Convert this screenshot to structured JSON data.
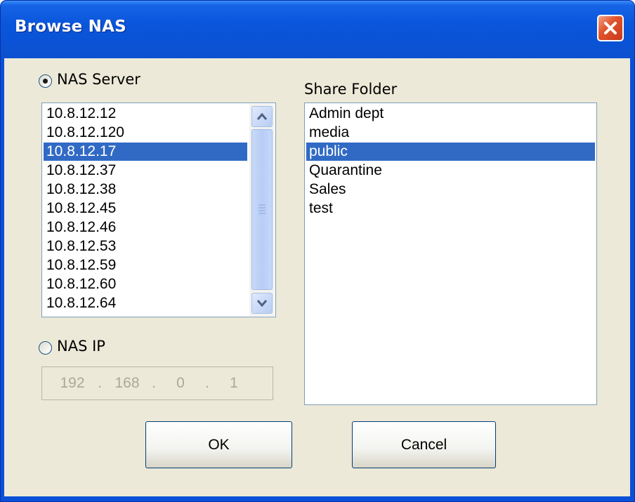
{
  "window": {
    "title": "Browse NAS"
  },
  "nas_server": {
    "label": "NAS Server",
    "selected": true,
    "items": [
      "10.8.12.12",
      "10.8.12.120",
      "10.8.12.17",
      "10.8.12.37",
      "10.8.12.38",
      "10.8.12.45",
      "10.8.12.46",
      "10.8.12.53",
      "10.8.12.59",
      "10.8.12.60",
      "10.8.12.64"
    ],
    "selected_item": "10.8.12.17"
  },
  "nas_ip": {
    "label": "NAS IP",
    "selected": false,
    "octets": [
      "192",
      "168",
      "0",
      "1"
    ],
    "separator": "."
  },
  "share_folder": {
    "label": "Share Folder",
    "items": [
      "Admin dept",
      "media",
      "public",
      "Quarantine",
      "Sales",
      "test"
    ],
    "selected_item": "public"
  },
  "buttons": {
    "ok": "OK",
    "cancel": "Cancel"
  },
  "colors": {
    "selection": "#316ac5",
    "dialog_bg": "#ece9d8",
    "titlebar": "#0a56dc"
  },
  "icons": {
    "close": "close-icon",
    "scroll_up": "chevron-up-icon",
    "scroll_down": "chevron-down-icon",
    "thumb_grip": "grip-icon"
  }
}
